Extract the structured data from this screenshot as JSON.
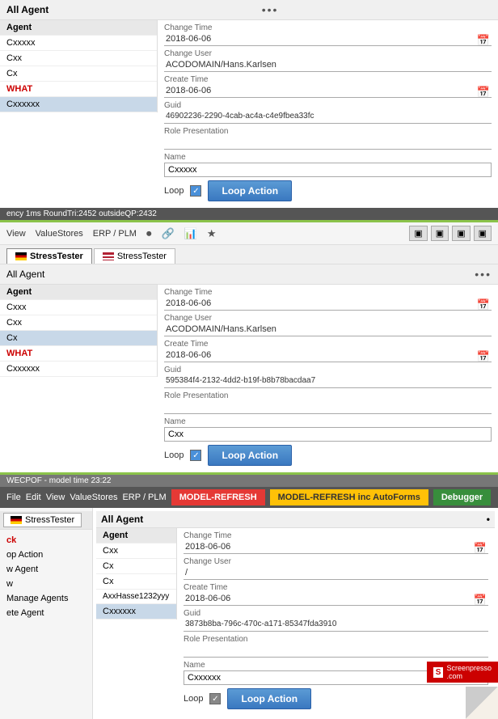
{
  "section1": {
    "title": "All Agent",
    "dots": "•••",
    "agent_col": "Agent",
    "agents": [
      {
        "name": "Cxxxxx",
        "selected": false
      },
      {
        "name": "Cxx",
        "selected": false
      },
      {
        "name": "Cx",
        "selected": false
      },
      {
        "name": "WHAT",
        "selected": false,
        "red": true
      },
      {
        "name": "Cxxxxxx",
        "selected": true
      }
    ],
    "change_time_label": "Change Time",
    "change_time": "2018-06-06",
    "change_user_label": "Change User",
    "change_user": "ACODOMAIN/Hans.Karlsen",
    "create_time_label": "Create Time",
    "create_time": "2018-06-06",
    "guid_label": "Guid",
    "guid": "46902236-2290-4cab-ac4a-c4e9fbea33fc",
    "role_presentation_label": "Role Presentation",
    "name_label": "Name",
    "name_value": "Cxxxxx",
    "loop_label": "Loop",
    "loop_action_label": "Loop Action",
    "status_bar": "ency 1ms  RoundTri:2452  outsideQP:2432"
  },
  "section2": {
    "toolbar": {
      "view": "View",
      "value_stores": "ValueStores",
      "erp_plm": "ERP / PLM"
    },
    "tabs": [
      {
        "label": "StressTester",
        "active": true,
        "flag": "de"
      },
      {
        "label": "StressTester",
        "active": false,
        "flag": "us"
      }
    ],
    "title": "All Agent",
    "dots": "•••",
    "agent_col": "Agent",
    "agents": [
      {
        "name": "Cxxx",
        "selected": false
      },
      {
        "name": "Cxx",
        "selected": false
      },
      {
        "name": "Cx",
        "selected": true
      },
      {
        "name": "WHAT",
        "selected": false,
        "red": true
      },
      {
        "name": "Cxxxxxx",
        "selected": false
      }
    ],
    "change_time_label": "Change Time",
    "change_time": "2018-06-06",
    "change_user_label": "Change User",
    "change_user": "ACODOMAIN/Hans.Karlsen",
    "create_time_label": "Create Time",
    "create_time": "2018-06-06",
    "guid_label": "Guid",
    "guid": "595384f4-2132-4dd2-b19f-b8b78bacdaa7",
    "role_presentation_label": "Role Presentation",
    "name_label": "Name",
    "name_value": "Cxx",
    "loop_label": "Loop",
    "loop_action_label": "Loop Action"
  },
  "section3": {
    "status_bar": "WECPOF - model time 23:22",
    "toolbar": {
      "file": "File",
      "edit": "Edit",
      "view": "View",
      "value_stores": "ValueStores",
      "erp_plm": "ERP / PLM"
    },
    "btn_model_refresh": "MODEL-REFRESH",
    "btn_model_refresh_auto": "MODEL-REFRESH inc AutoForms",
    "btn_debugger": "Debugger",
    "tab": "StressTester",
    "title": "All Agent",
    "dots": "•",
    "agent_col": "Agent",
    "agents": [
      {
        "name": "Cxx",
        "selected": false
      },
      {
        "name": "Cx",
        "selected": false
      },
      {
        "name": "Cx",
        "selected": false
      },
      {
        "name": "AxxHasse1232yyy",
        "selected": false
      },
      {
        "name": "Cxxxxxx",
        "selected": true
      }
    ],
    "change_time_label": "Change Time",
    "change_time": "2018-06-06",
    "change_user_label": "Change User",
    "change_user": "/",
    "create_time_label": "Create Time",
    "create_time": "2018-06-06",
    "guid_label": "Guid",
    "guid": "3873b8ba-796c-470c-a171-85347fda3910",
    "role_presentation_label": "Role Presentation",
    "name_label": "Name",
    "name_value": "Cxxxxxx",
    "loop_label": "Loop",
    "loop_action_label": "Loop Action",
    "sidebar_items": [
      {
        "label": "ck",
        "id": "ck"
      },
      {
        "label": "op Action",
        "id": "op-action"
      },
      {
        "label": "w Agent",
        "id": "w-agent"
      },
      {
        "label": "w",
        "id": "w"
      },
      {
        "label": "Manage Agents",
        "id": "manage-agents"
      },
      {
        "label": "ete Agent",
        "id": "ete-agent"
      }
    ]
  },
  "screenpresso": {
    "logo": "S",
    "text": "Screenpresso\n.com"
  }
}
